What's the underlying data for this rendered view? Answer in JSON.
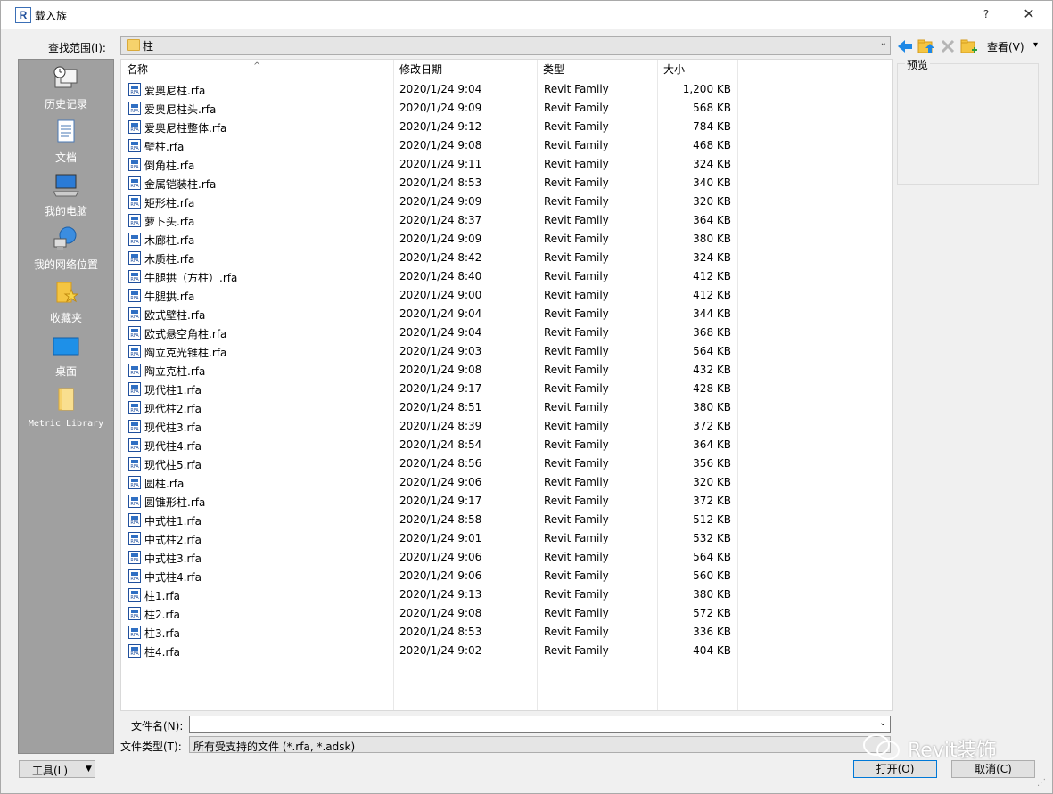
{
  "window": {
    "title": "载入族",
    "app_icon_letter": "R",
    "help_glyph": "?",
    "close_glyph": "✕"
  },
  "lookin": {
    "label": "查找范围(I):",
    "value": "柱",
    "dropdown_glyph": "⌄"
  },
  "toolbar": {
    "view_label": "查看(V)",
    "view_dropdown_glyph": "▾",
    "icons": [
      "back-arrow-icon",
      "up-folder-icon",
      "delete-icon",
      "new-folder-icon"
    ]
  },
  "places": [
    {
      "label": "历史记录",
      "icon": "history-icon"
    },
    {
      "label": "文档",
      "icon": "documents-icon"
    },
    {
      "label": "我的电脑",
      "icon": "computer-icon"
    },
    {
      "label": "我的网络位置",
      "icon": "network-icon"
    },
    {
      "label": "收藏夹",
      "icon": "favorites-icon"
    },
    {
      "label": "桌面",
      "icon": "desktop-icon"
    },
    {
      "label": "Metric Library",
      "icon": "folder-icon"
    }
  ],
  "columns": {
    "name": "名称",
    "date": "修改日期",
    "type": "类型",
    "size": "大小",
    "sort_glyph": "^"
  },
  "files": [
    {
      "name": "爱奥尼柱.rfa",
      "date": "2020/1/24 9:04",
      "type": "Revit Family",
      "size": "1,200 KB"
    },
    {
      "name": "爱奥尼柱头.rfa",
      "date": "2020/1/24 9:09",
      "type": "Revit Family",
      "size": "568 KB"
    },
    {
      "name": "爱奥尼柱整体.rfa",
      "date": "2020/1/24 9:12",
      "type": "Revit Family",
      "size": "784 KB"
    },
    {
      "name": "壁柱.rfa",
      "date": "2020/1/24 9:08",
      "type": "Revit Family",
      "size": "468 KB"
    },
    {
      "name": "倒角柱.rfa",
      "date": "2020/1/24 9:11",
      "type": "Revit Family",
      "size": "324 KB"
    },
    {
      "name": "金属铠装柱.rfa",
      "date": "2020/1/24 8:53",
      "type": "Revit Family",
      "size": "340 KB"
    },
    {
      "name": "矩形柱.rfa",
      "date": "2020/1/24 9:09",
      "type": "Revit Family",
      "size": "320 KB"
    },
    {
      "name": "萝卜头.rfa",
      "date": "2020/1/24 8:37",
      "type": "Revit Family",
      "size": "364 KB"
    },
    {
      "name": "木廊柱.rfa",
      "date": "2020/1/24 9:09",
      "type": "Revit Family",
      "size": "380 KB"
    },
    {
      "name": "木质柱.rfa",
      "date": "2020/1/24 8:42",
      "type": "Revit Family",
      "size": "324 KB"
    },
    {
      "name": "牛腿拱（方柱）.rfa",
      "date": "2020/1/24 8:40",
      "type": "Revit Family",
      "size": "412 KB"
    },
    {
      "name": "牛腿拱.rfa",
      "date": "2020/1/24 9:00",
      "type": "Revit Family",
      "size": "412 KB"
    },
    {
      "name": "欧式壁柱.rfa",
      "date": "2020/1/24 9:04",
      "type": "Revit Family",
      "size": "344 KB"
    },
    {
      "name": "欧式悬空角柱.rfa",
      "date": "2020/1/24 9:04",
      "type": "Revit Family",
      "size": "368 KB"
    },
    {
      "name": "陶立克光锥柱.rfa",
      "date": "2020/1/24 9:03",
      "type": "Revit Family",
      "size": "564 KB"
    },
    {
      "name": "陶立克柱.rfa",
      "date": "2020/1/24 9:08",
      "type": "Revit Family",
      "size": "432 KB"
    },
    {
      "name": "现代柱1.rfa",
      "date": "2020/1/24 9:17",
      "type": "Revit Family",
      "size": "428 KB"
    },
    {
      "name": "现代柱2.rfa",
      "date": "2020/1/24 8:51",
      "type": "Revit Family",
      "size": "380 KB"
    },
    {
      "name": "现代柱3.rfa",
      "date": "2020/1/24 8:39",
      "type": "Revit Family",
      "size": "372 KB"
    },
    {
      "name": "现代柱4.rfa",
      "date": "2020/1/24 8:54",
      "type": "Revit Family",
      "size": "364 KB"
    },
    {
      "name": "现代柱5.rfa",
      "date": "2020/1/24 8:56",
      "type": "Revit Family",
      "size": "356 KB"
    },
    {
      "name": "圆柱.rfa",
      "date": "2020/1/24 9:06",
      "type": "Revit Family",
      "size": "320 KB"
    },
    {
      "name": "圆锥形柱.rfa",
      "date": "2020/1/24 9:17",
      "type": "Revit Family",
      "size": "372 KB"
    },
    {
      "name": "中式柱1.rfa",
      "date": "2020/1/24 8:58",
      "type": "Revit Family",
      "size": "512 KB"
    },
    {
      "name": "中式柱2.rfa",
      "date": "2020/1/24 9:01",
      "type": "Revit Family",
      "size": "532 KB"
    },
    {
      "name": "中式柱3.rfa",
      "date": "2020/1/24 9:06",
      "type": "Revit Family",
      "size": "564 KB"
    },
    {
      "name": "中式柱4.rfa",
      "date": "2020/1/24 9:06",
      "type": "Revit Family",
      "size": "560 KB"
    },
    {
      "name": "柱1.rfa",
      "date": "2020/1/24 9:13",
      "type": "Revit Family",
      "size": "380 KB"
    },
    {
      "name": "柱2.rfa",
      "date": "2020/1/24 9:08",
      "type": "Revit Family",
      "size": "572 KB"
    },
    {
      "name": "柱3.rfa",
      "date": "2020/1/24 8:53",
      "type": "Revit Family",
      "size": "336 KB"
    },
    {
      "name": "柱4.rfa",
      "date": "2020/1/24 9:02",
      "type": "Revit Family",
      "size": "404 KB"
    }
  ],
  "preview": {
    "label": "预览"
  },
  "filename": {
    "label": "文件名(N):",
    "value": "",
    "dropdown_glyph": "⌄"
  },
  "filetype": {
    "label": "文件类型(T):",
    "value": "所有受支持的文件 (*.rfa, *.adsk)"
  },
  "buttons": {
    "tools": "工具(L)",
    "tools_dropdown_glyph": "▼",
    "open": "打开(O)",
    "cancel": "取消(C)"
  },
  "watermark": {
    "text": "Revit装饰"
  },
  "colors": {
    "places_bg": "#a0a0a0",
    "accent": "#0078d7",
    "rfa_icon": "#1f4f9c"
  }
}
